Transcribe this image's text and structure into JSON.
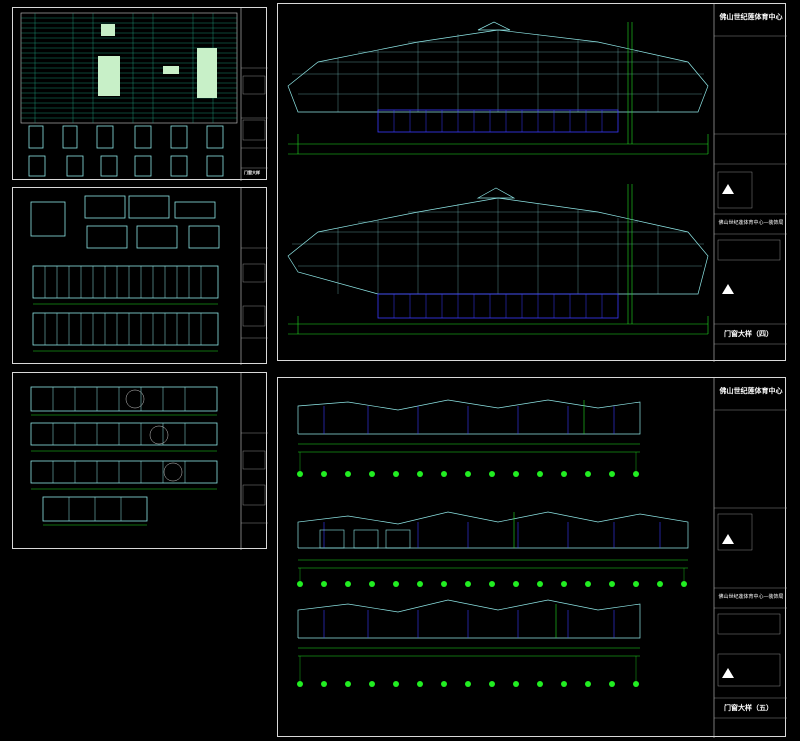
{
  "project_title": "佛山世纪莲体育中心",
  "sheet_subtitle": "佛山世纪莲体育中心—装饰局",
  "sheet_names": [
    "门窗大样（四）",
    "门窗大样（五）"
  ],
  "small_sheet_stamp": "门窗大样",
  "colors": {
    "background": "#000000",
    "frame": "#d8d8d8",
    "drawing_white": "#ffffff",
    "drawing_cyan": "#8ee6e6",
    "drawing_green": "#22dd22",
    "drawing_blue": "#3a3aff",
    "grid_bubble": "#22ee22"
  }
}
